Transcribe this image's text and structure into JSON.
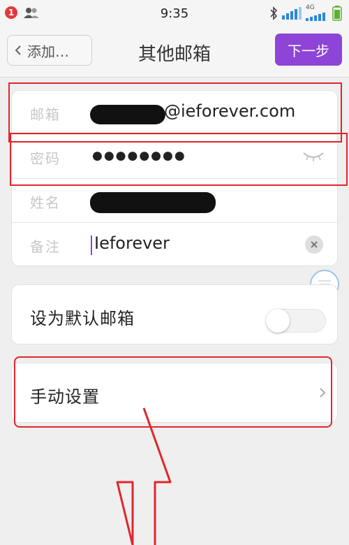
{
  "status_bar": {
    "notification_count": "1",
    "time": "9:35",
    "network_label": "4G"
  },
  "nav": {
    "back_label": "添加…",
    "title": "其他邮箱",
    "next_label": "下一步"
  },
  "form": {
    "email": {
      "label": "邮箱",
      "value": "@ieforever.com"
    },
    "password": {
      "label": "密码",
      "value": "●●●●●●●●"
    },
    "name": {
      "label": "姓名"
    },
    "note": {
      "label": "备注",
      "value": "Ieforever"
    }
  },
  "default_mailbox": {
    "label": "设为默认邮箱",
    "enabled": false
  },
  "manual_setup": {
    "label": "手动设置"
  },
  "colors": {
    "accent": "#8e44d6",
    "annotation": "#e0262b"
  }
}
